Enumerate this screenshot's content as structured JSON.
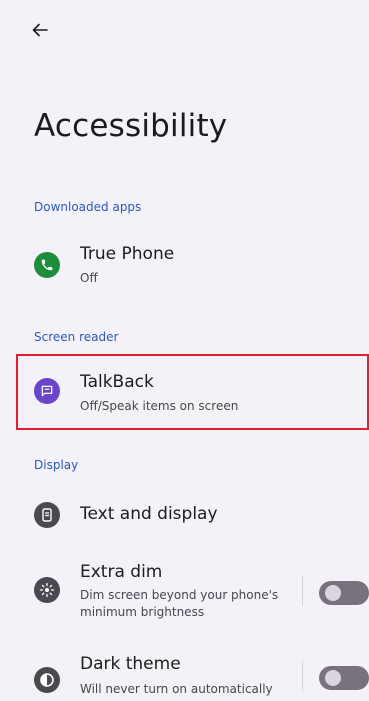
{
  "header": {
    "title": "Accessibility"
  },
  "sections": {
    "downloaded": "Downloaded apps",
    "screen_reader": "Screen reader",
    "display": "Display"
  },
  "items": {
    "true_phone": {
      "title": "True Phone",
      "subtitle": "Off",
      "icon": "phone-icon",
      "color": "#1e8e3e"
    },
    "talkback": {
      "title": "TalkBack",
      "subtitle": "Off/Speak items on screen",
      "icon": "talkback-icon",
      "color": "#6a45c9"
    },
    "text_display": {
      "title": "Text and display",
      "icon": "text-display-icon",
      "color": "#4a4850"
    },
    "extra_dim": {
      "title": "Extra dim",
      "subtitle_line1": "Dim screen beyond your phone's",
      "subtitle_line2": "minimum brightness",
      "icon": "extra-dim-icon",
      "toggle": false
    },
    "dark_theme": {
      "title": "Dark theme",
      "subtitle": "Will never turn on automatically",
      "icon": "dark-theme-icon",
      "toggle": false
    }
  },
  "colors": {
    "accent": "#2b5bb5",
    "highlight": "#e0202a",
    "background": "#f4f1f8"
  }
}
